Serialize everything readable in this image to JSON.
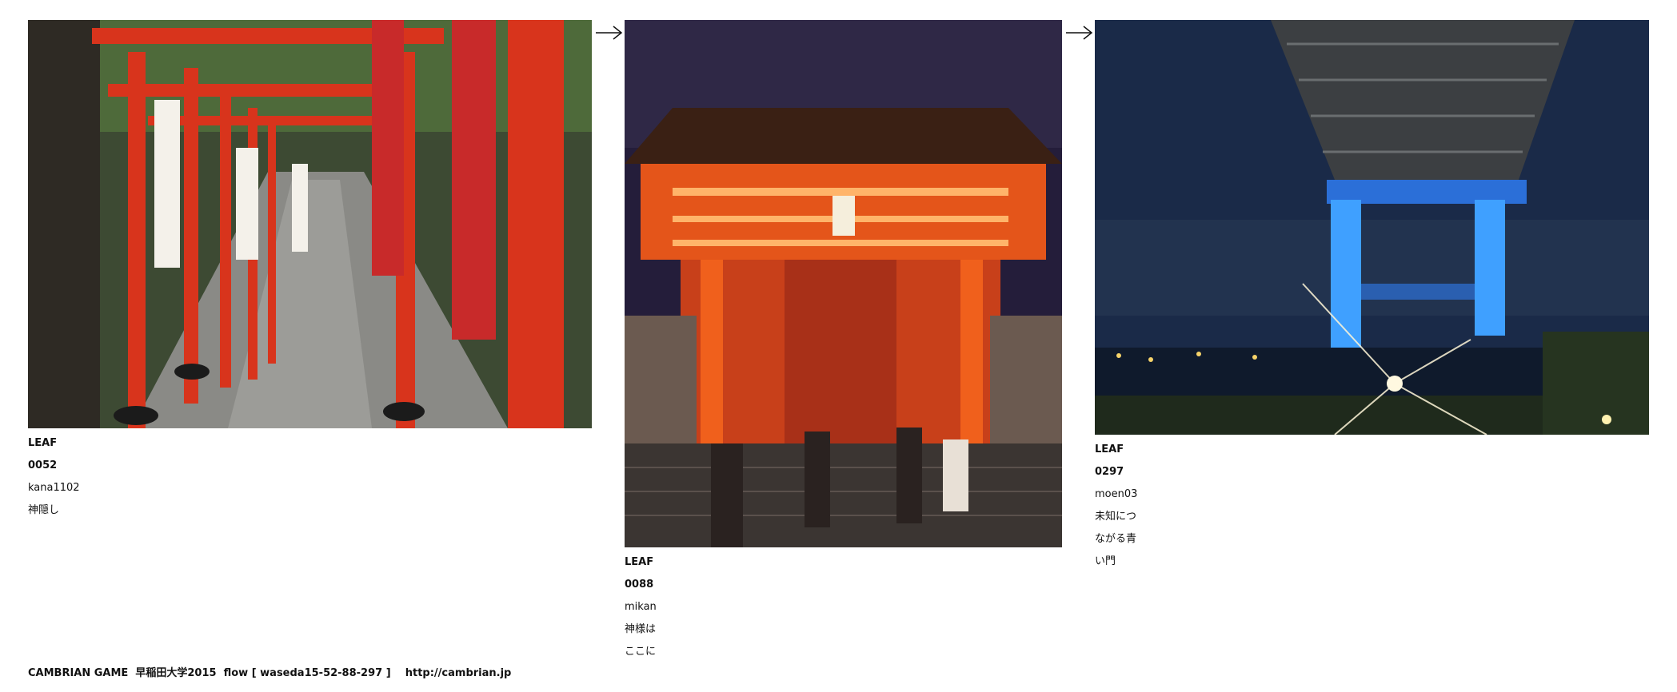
{
  "leaves": [
    {
      "id": "LEAF 0052",
      "user": "kana1102",
      "title": "神隠し",
      "image": "red-torii-gate-tunnel-with-banners"
    },
    {
      "id": "LEAF 0088",
      "user": "mikan",
      "title": "神様はここに",
      "image": "illuminated-shrine-gate-at-dusk"
    },
    {
      "id": "LEAF 0297",
      "user": "moen03",
      "title": "未知につながる青い門",
      "image": "bridge-with-blue-lit-pillars-at-night"
    }
  ],
  "arrows": [
    "arrow-right-icon",
    "arrow-right-icon"
  ],
  "footer": {
    "text": "CAMBRIAN GAME  早稲田大学2015  flow [ waseda15-52-88-297 ]    http://cambrian.jp"
  },
  "colors": {
    "torii_red": "#d8341c",
    "shrine_orange": "#f0601c",
    "bridge_blue": "#3fa0ff"
  }
}
